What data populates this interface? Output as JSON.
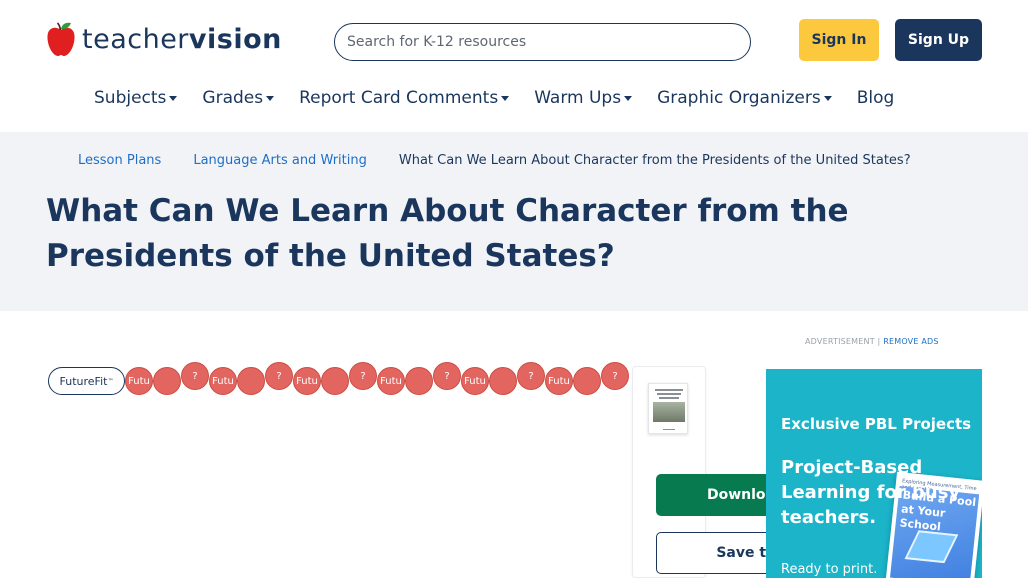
{
  "header": {
    "logo_part1": "teacher",
    "logo_part2": "vision",
    "search_placeholder": "Search for K-12 resources",
    "sign_in_label": "Sign In",
    "sign_up_label": "Sign Up"
  },
  "nav": {
    "items": [
      {
        "label": "Subjects",
        "has_dropdown": true
      },
      {
        "label": "Grades",
        "has_dropdown": true
      },
      {
        "label": "Report Card Comments",
        "has_dropdown": true
      },
      {
        "label": "Warm Ups",
        "has_dropdown": true
      },
      {
        "label": "Graphic Organizers",
        "has_dropdown": true
      },
      {
        "label": "Blog",
        "has_dropdown": false
      }
    ]
  },
  "breadcrumb": [
    "Lesson Plans",
    "Language Arts and Writing",
    "What Can We Learn About Character from the Presidents of the United States?"
  ],
  "page_title": "What Can We Learn About Character from the Presidents of the United States?",
  "ad_label": {
    "prefix": "ADVERTISEMENT |",
    "remove": "REMOVE ADS"
  },
  "futurefit": {
    "pill_label": "FutureFit",
    "pill_mark": "™",
    "badges": [
      "Futu",
      "",
      "?",
      "Futu",
      "",
      "?",
      "Futu",
      "",
      "?",
      "Futu",
      "",
      "?",
      "Futu",
      "",
      "?",
      "Futu",
      "",
      "?"
    ]
  },
  "resource": {
    "download_label": "Download",
    "save_label": "Save to"
  },
  "ad": {
    "heading": "Exclusive PBL Projects",
    "headline": "Project-Based Learning for busy teachers.",
    "ready_text": "Ready to print.",
    "book_topline": "Exploring Measurement, Time and Graphing",
    "book_title": "Build a Pool at Your School"
  },
  "colors": {
    "navy": "#1b365d",
    "yellow": "#fcc93e",
    "link_blue": "#1f6fc6",
    "green": "#077a4f",
    "hero_bg": "#f2f3f6",
    "ad_teal": "#1bb4c9",
    "badge_red": "#e2665f",
    "apple_red": "#e02020"
  }
}
